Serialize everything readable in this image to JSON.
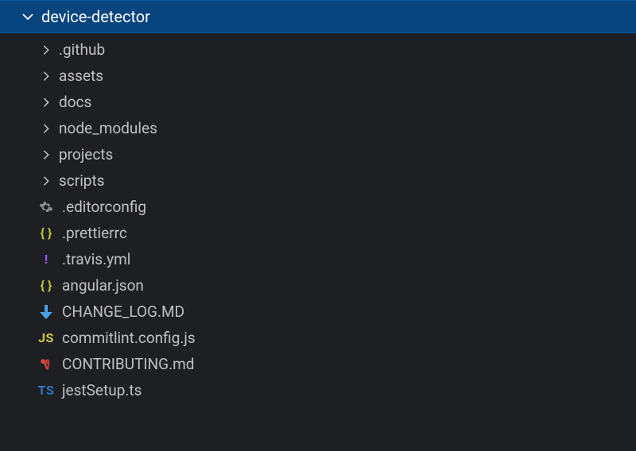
{
  "root": {
    "name": "device-detector",
    "expanded": true
  },
  "folders": [
    {
      "name": ".github"
    },
    {
      "name": "assets"
    },
    {
      "name": "docs"
    },
    {
      "name": "node_modules"
    },
    {
      "name": "projects"
    },
    {
      "name": "scripts"
    }
  ],
  "files": [
    {
      "name": ".editorconfig",
      "icon": "gear"
    },
    {
      "name": ".prettierrc",
      "icon": "json"
    },
    {
      "name": ".travis.yml",
      "icon": "excl"
    },
    {
      "name": "angular.json",
      "icon": "json"
    },
    {
      "name": "CHANGE_LOG.MD",
      "icon": "md"
    },
    {
      "name": "commitlint.config.js",
      "icon": "js"
    },
    {
      "name": "CONTRIBUTING.md",
      "icon": "keys"
    },
    {
      "name": "jestSetup.ts",
      "icon": "ts"
    }
  ]
}
